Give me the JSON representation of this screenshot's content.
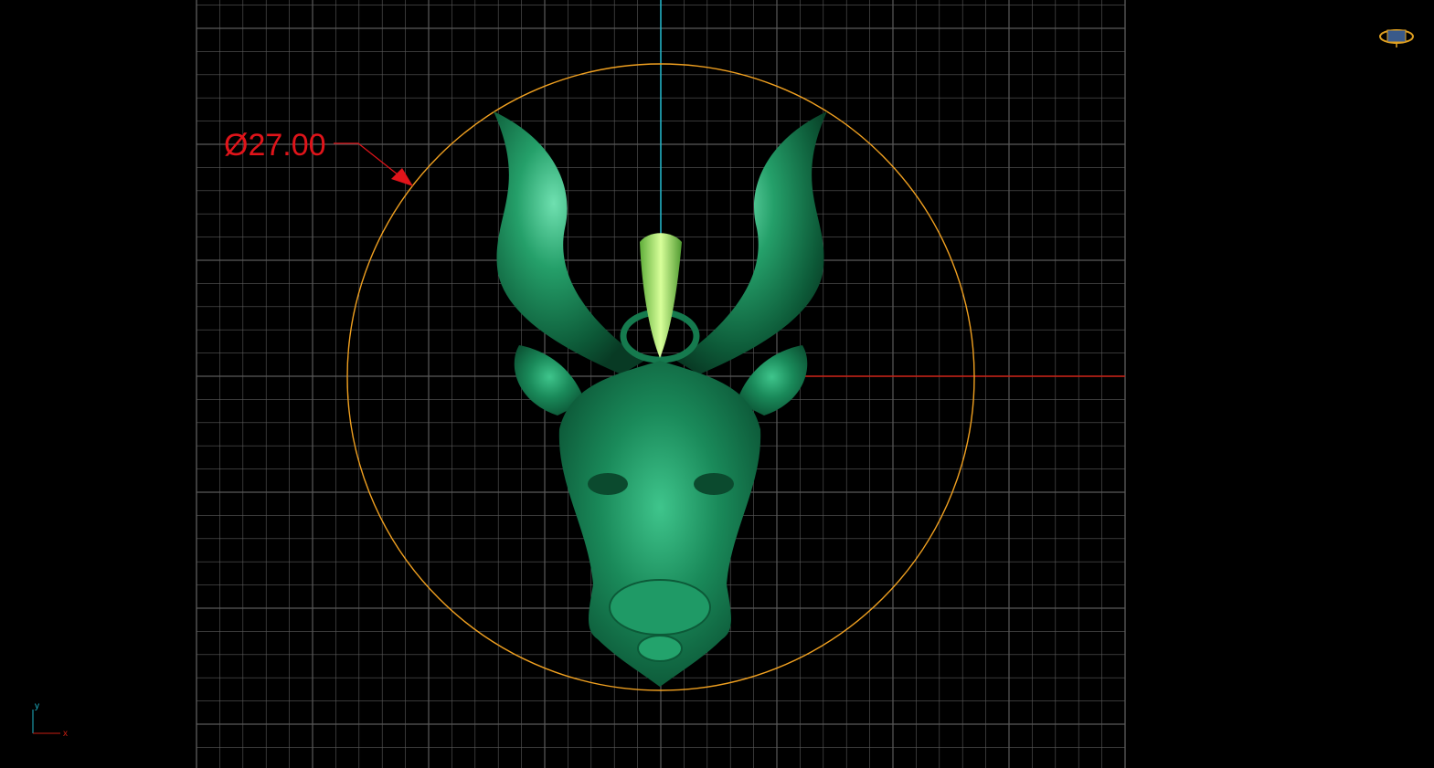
{
  "viewport": {
    "view": "Top",
    "background": "#000000",
    "grid_color": "#5a5a5a",
    "y_axis_color": "#1fb6c9",
    "x_axis_color": "#c81e12"
  },
  "dimension": {
    "label": "Ø27.00",
    "color": "#e0141a"
  },
  "reference_circle": {
    "color": "#f0a020"
  },
  "model": {
    "name": "bull-head-pendant",
    "body_color": "#1a8a5a",
    "bail_color": "#8ed650"
  },
  "axis_indicator": {
    "y_label": "y",
    "x_label": "x"
  },
  "navigation_widget": {
    "icon": "view-cube-icon",
    "color": "#e0a020"
  }
}
